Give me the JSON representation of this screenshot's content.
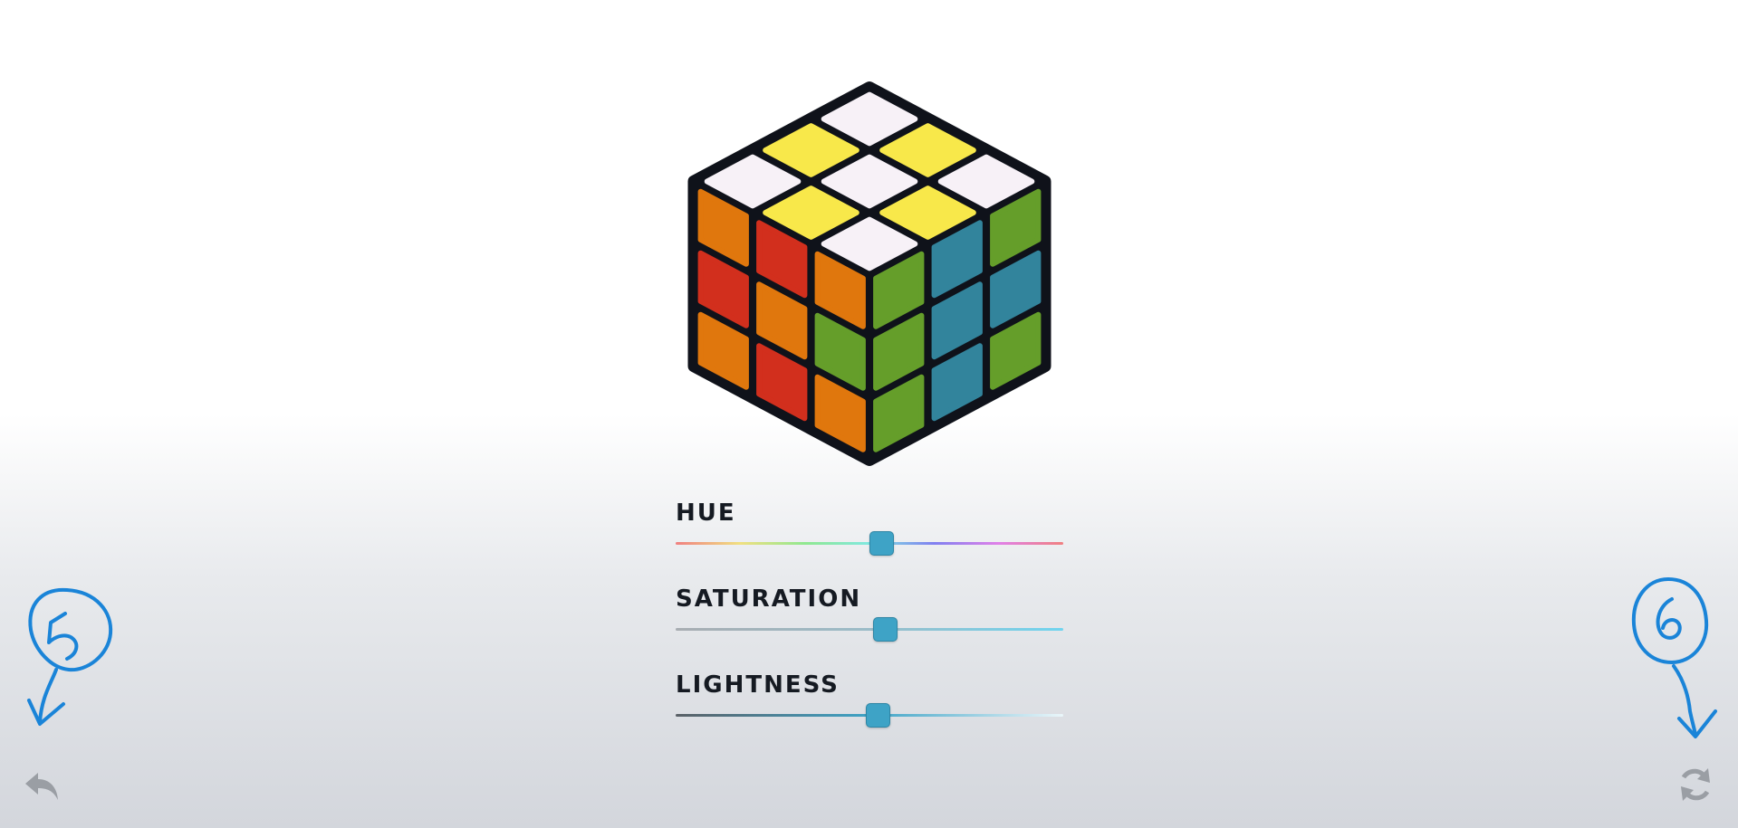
{
  "cube": {
    "sticker_colors": {
      "white": "#f7f1f7",
      "yellow": "#f8e84a",
      "orange": "#e0770d",
      "red": "#d22f1d",
      "green": "#659e2a",
      "blue": "#32849c",
      "body": "#0f121a"
    },
    "top_face": [
      [
        "white",
        "yellow",
        "white"
      ],
      [
        "yellow",
        "white",
        "yellow"
      ],
      [
        "white",
        "yellow",
        "white"
      ]
    ],
    "left_face": [
      [
        "orange",
        "red",
        "orange"
      ],
      [
        "red",
        "orange",
        "green"
      ],
      [
        "orange",
        "red",
        "orange"
      ]
    ],
    "right_face": [
      [
        "green",
        "blue",
        "green"
      ],
      [
        "green",
        "blue",
        "blue"
      ],
      [
        "green",
        "blue",
        "green"
      ]
    ]
  },
  "controls": {
    "hue": {
      "label": "HUE",
      "value": 0.53
    },
    "saturation": {
      "label": "SATURATION",
      "value": 0.54
    },
    "lightness": {
      "label": "LIGHTNESS",
      "value": 0.52
    }
  },
  "annotations": {
    "left": {
      "text": "5",
      "color": "#1a84d8"
    },
    "right": {
      "text": "6",
      "color": "#1a84d8"
    }
  },
  "buttons": {
    "undo": {
      "icon": "undo-icon"
    },
    "reset": {
      "icon": "refresh-icon"
    }
  }
}
